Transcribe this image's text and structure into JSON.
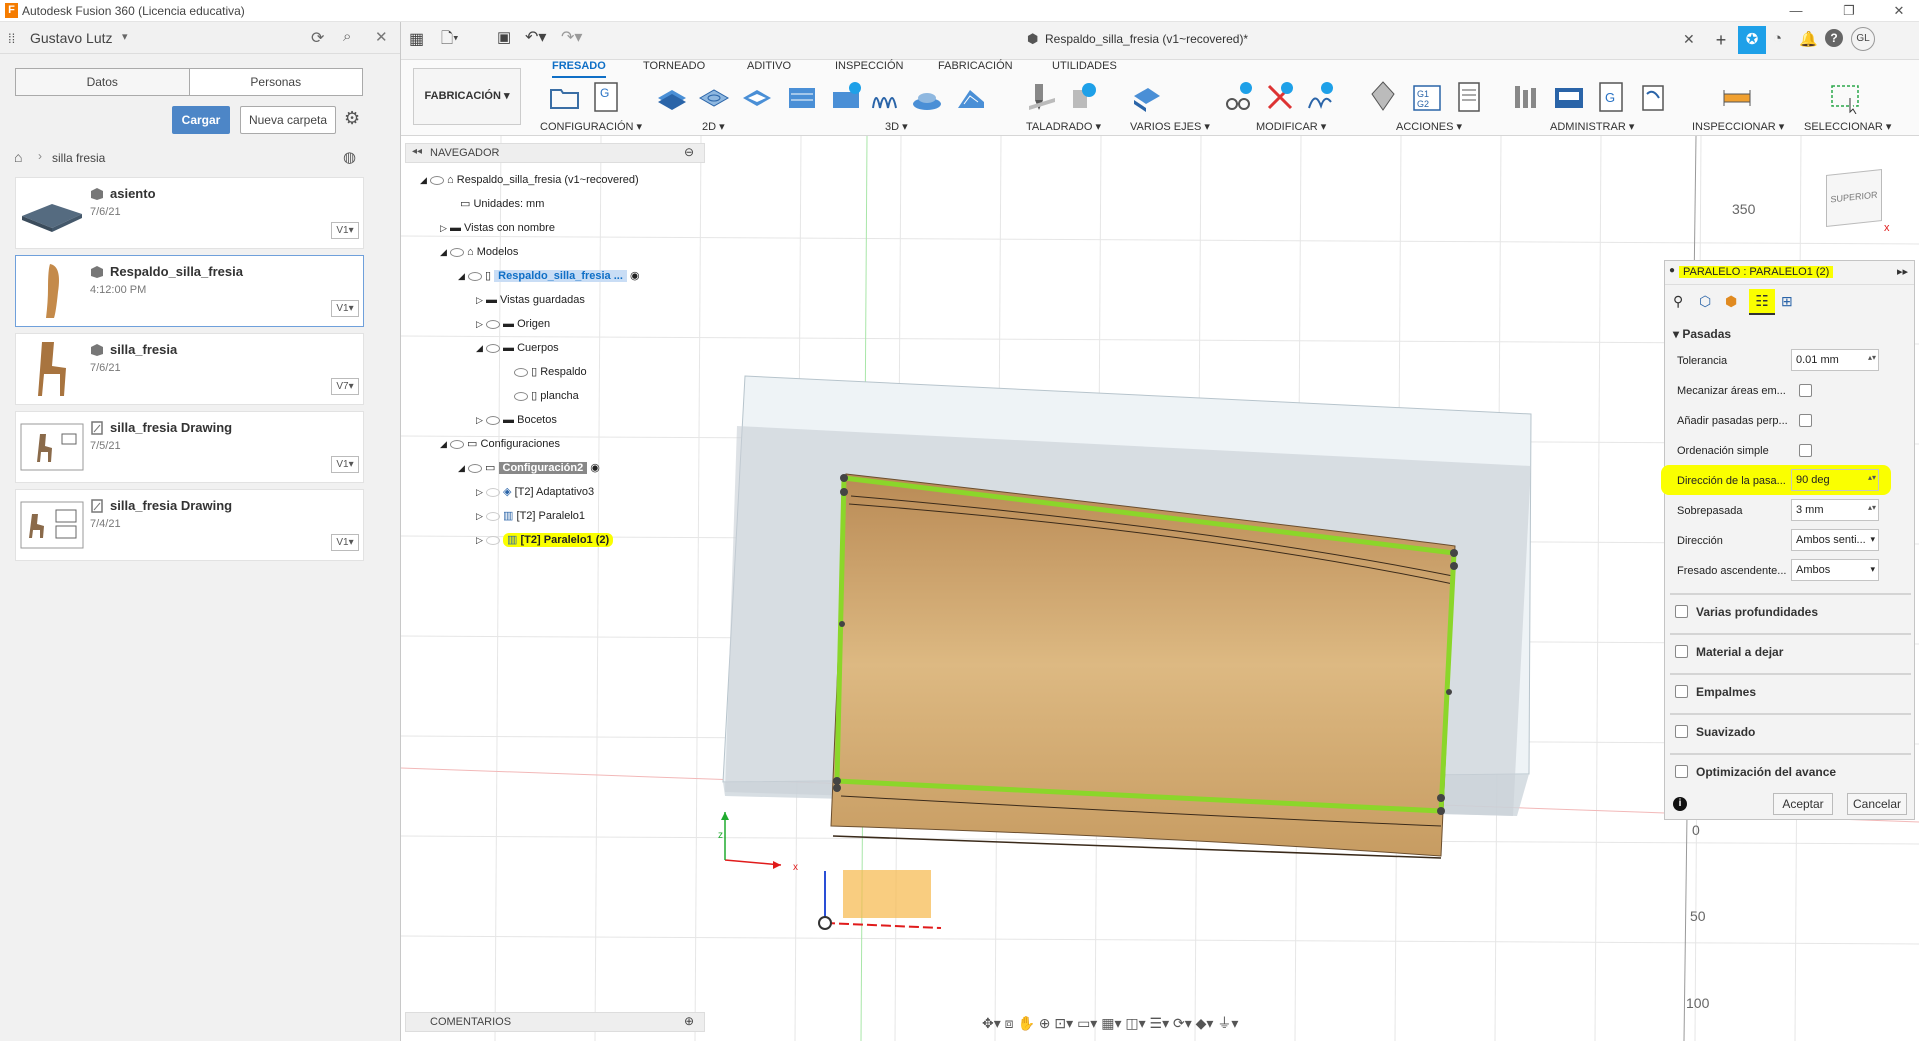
{
  "window": {
    "title": "Autodesk Fusion 360 (Licencia educativa)"
  },
  "left_panel": {
    "user": "Gustavo Lutz",
    "tabs": [
      "Datos",
      "Personas"
    ],
    "upload_label": "Cargar",
    "new_folder_label": "Nueva carpeta",
    "breadcrumb": "silla fresia",
    "files": [
      {
        "name": "asiento",
        "date": "7/6/21",
        "version": "V1"
      },
      {
        "name": "Respaldo_silla_fresia",
        "date": "4:12:00 PM",
        "version": "V1"
      },
      {
        "name": "silla_fresia",
        "date": "7/6/21",
        "version": "V7"
      },
      {
        "name": "silla_fresia Drawing",
        "date": "7/5/21",
        "version": "V1"
      },
      {
        "name": "silla_fresia Drawing",
        "date": "7/4/21",
        "version": "V1"
      }
    ]
  },
  "document": {
    "tab_title": "Respaldo_silla_fresia (v1~recovered)*",
    "user_initials": "GL"
  },
  "workspace": {
    "name": "FABRICACIÓN",
    "tabs": [
      "FRESADO",
      "TORNEADO",
      "ADITIVO",
      "INSPECCIÓN",
      "FABRICACIÓN",
      "UTILIDADES"
    ],
    "groups": [
      "CONFIGURACIÓN",
      "2D",
      "3D",
      "TALADRADO",
      "VARIOS EJES",
      "MODIFICAR",
      "ACCIONES",
      "ADMINISTRAR",
      "INSPECCIONAR",
      "SELECCIONAR"
    ]
  },
  "navigator": {
    "title": "NAVEGADOR",
    "comments": "COMENTARIOS",
    "rows": [
      "Respaldo_silla_fresia (v1~recovered)",
      "Unidades: mm",
      "Vistas con nombre",
      "Modelos",
      "Respaldo_silla_fresia ...",
      "Vistas guardadas",
      "Origen",
      "Cuerpos",
      "Respaldo",
      "plancha",
      "Bocetos",
      "Configuraciones",
      "Configuración2",
      "[T2] Adaptativo3",
      "[T2] Paralelo1",
      "[T2] Paralelo1 (2)"
    ]
  },
  "viewcube": {
    "label": "SUPERIOR"
  },
  "ruler": {
    "marks": [
      "350",
      "0",
      "50",
      "100"
    ]
  },
  "panel": {
    "title": "PARALELO : PARALELO1 (2)",
    "section": "Pasadas",
    "fields": {
      "tolerance_label": "Tolerancia",
      "tolerance_value": "0.01 mm",
      "machine_areas_label": "Mecanizar áreas em...",
      "add_passes_label": "Añadir pasadas perp...",
      "simple_order_label": "Ordenación simple",
      "pass_direction_label": "Dirección de la pasa...",
      "pass_direction_value": "90 deg",
      "overlap_label": "Sobrepasada",
      "overlap_value": "3 mm",
      "direction_label": "Dirección",
      "direction_value": "Ambos senti...",
      "climb_label": "Fresado ascendente...",
      "climb_value": "Ambos"
    },
    "sections": [
      "Varias profundidades",
      "Material a dejar",
      "Empalmes",
      "Suavizado",
      "Optimización del avance"
    ],
    "ok_label": "Aceptar",
    "cancel_label": "Cancelar"
  },
  "colors": {
    "accent": "#0f6fc6",
    "highlight": "#faff00",
    "toolpath": "#8bd62a",
    "wood": "#d9b47a"
  }
}
